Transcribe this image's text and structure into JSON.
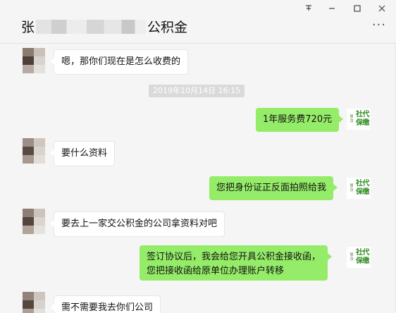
{
  "window": {
    "title_prefix": "张",
    "title_suffix": "公积金",
    "pin_icon": "pin-icon",
    "minimize_icon": "minimize-icon",
    "maximize_icon": "maximize-icon",
    "close_icon": "close-icon",
    "more_icon": "more-icon"
  },
  "messages": {
    "m1": "嗯，那你们现在是怎么收费的",
    "timestamp": "2019年10月14日 16:15",
    "m2": "1年服务费720元",
    "m3": "要什么资料",
    "m4": "您把身份证正反面拍照给我",
    "m5": "要去上一家交公积金的公司拿资料对吧",
    "m6_line1": "签订协议后，我会给您开具公积金接收函，",
    "m6_line2": "您把接收函给原单位办理账户转移",
    "m7": "需不需要我去你们公司"
  },
  "logo": {
    "small_top": "慧",
    "small_bottom": "汉",
    "line1": "社代",
    "line2": "保缴"
  },
  "colors": {
    "sent_bubble": "#95ec69",
    "received_bubble": "#ffffff",
    "background": "#f5f5f5"
  }
}
